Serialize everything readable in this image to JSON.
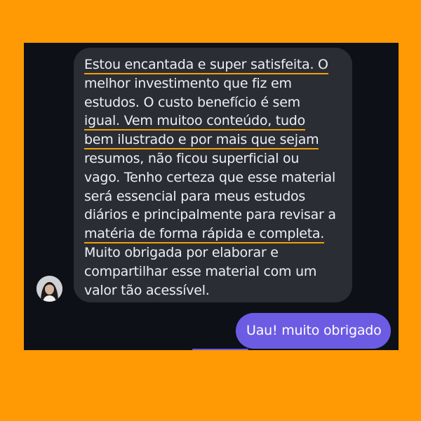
{
  "conversation": {
    "incoming": {
      "sender_avatar": "avatar-woman-photo",
      "lines": [
        "Estou encantada e super satisfeita. O",
        "melhor investimento que fiz em",
        "estudos. O custo benefício é sem",
        "igual. Vem muitoo conteúdo, tudo",
        "bem ilustrado e por mais que sejam",
        "resumos, não ficou superficial ou",
        "vago. Tenho certeza que esse material",
        "será essencial para meus estudos",
        "diários e principalmente para revisar a",
        "matéria de forma rápida e completa.",
        "Muito obrigada por elaborar e",
        "compartilhar esse material com um",
        "valor tão acessível."
      ]
    },
    "outgoing": {
      "text": "Uau! muito obrigado"
    }
  },
  "colors": {
    "page_background": "#ff9a05",
    "chat_background": "#0d1117",
    "incoming_bubble": "#2a2d33",
    "outgoing_bubble": "#6c5ce4",
    "highlight_underline": "#f2a008"
  }
}
